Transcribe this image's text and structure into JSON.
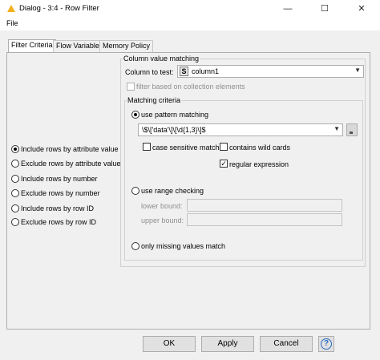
{
  "window": {
    "title": "Dialog - 3:4 - Row Filter",
    "minimize": "—",
    "maximize": "☐",
    "close": "✕",
    "icon": "warning-triangle-icon"
  },
  "menu": {
    "file": "File"
  },
  "tabs": [
    {
      "label": "Filter Criteria",
      "active": true
    },
    {
      "label": "Flow Variables",
      "active": false
    },
    {
      "label": "Memory Policy",
      "active": false
    }
  ],
  "left_options": [
    {
      "label": "Include rows by attribute value",
      "selected": true
    },
    {
      "label": "Exclude rows by attribute value",
      "selected": false
    },
    {
      "label": "Include rows by number",
      "selected": false
    },
    {
      "label": "Exclude rows by number",
      "selected": false
    },
    {
      "label": "Include rows by row ID",
      "selected": false
    },
    {
      "label": "Exclude rows by row ID",
      "selected": false
    }
  ],
  "column_matching": {
    "legend": "Column value matching",
    "column_label": "Column to test:",
    "column_type_badge": "S",
    "column_value": "column1",
    "collection_label": "filter based on collection elements"
  },
  "matching_criteria": {
    "legend": "Matching criteria",
    "pattern_label": "use pattern matching",
    "pattern_value": "\\$\\['data'\\]\\[\\d{1,3}\\]$",
    "case_sensitive": "case sensitive match",
    "wild_cards": "contains wild cards",
    "regex": "regular expression",
    "regex_checked": true,
    "range_label": "use range checking",
    "lower_bound": "lower bound:",
    "upper_bound": "upper bound:",
    "missing_label": "only missing values match"
  },
  "buttons": {
    "ok": "OK",
    "apply": "Apply",
    "cancel": "Cancel",
    "help": "?"
  }
}
